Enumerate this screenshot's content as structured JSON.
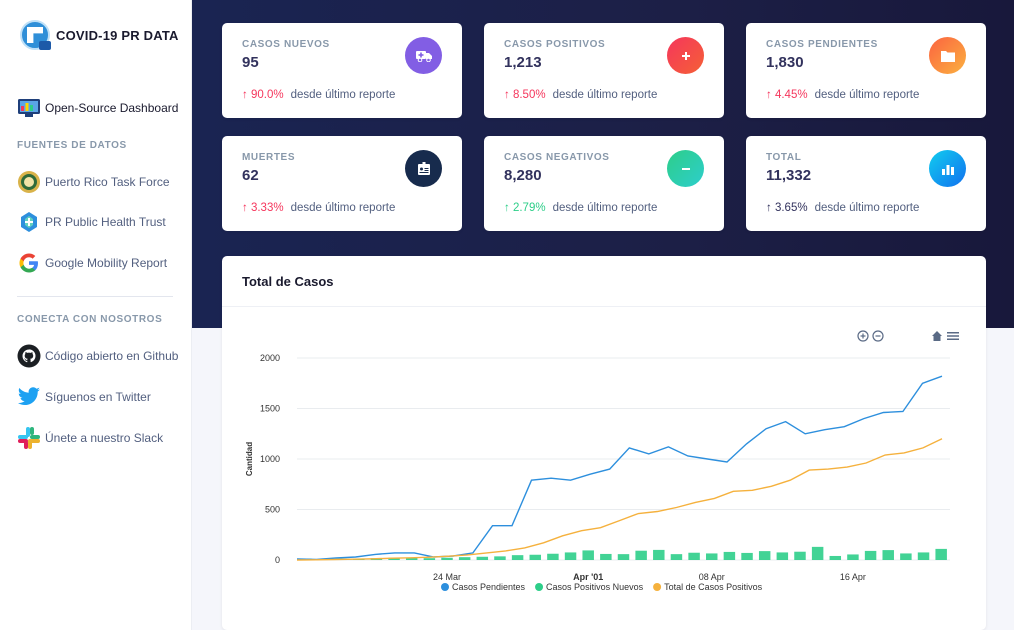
{
  "brand": {
    "title": "COVID-19 PR DATA"
  },
  "sidebar": {
    "dashboard_label": "Open-Source Dashboard",
    "section_sources": "FUENTES DE DATOS",
    "sources": [
      {
        "label": "Puerto Rico Task Force"
      },
      {
        "label": "PR Public Health Trust"
      },
      {
        "label": "Google Mobility Report"
      }
    ],
    "section_connect": "CONECTA CON NOSOTROS",
    "connect": [
      {
        "label": "Código abierto en Github"
      },
      {
        "label": "Síguenos en Twitter"
      },
      {
        "label": "Únete a nuestro Slack"
      }
    ]
  },
  "stats": [
    {
      "label": "CASOS NUEVOS",
      "value": "95",
      "change": "90.0%",
      "arrow": "↑",
      "note": "desde último reporte",
      "icon": "ambulance-icon",
      "color": "#825ee4"
    },
    {
      "label": "CASOS POSITIVOS",
      "value": "1,213",
      "change": "8.50%",
      "arrow": "↑",
      "note": "desde último reporte",
      "icon": "plus-icon",
      "color": "#f5365c"
    },
    {
      "label": "CASOS PENDIENTES",
      "value": "1,830",
      "change": "4.45%",
      "arrow": "↑",
      "note": "desde último reporte",
      "icon": "folder-icon",
      "color": "#fb6340"
    },
    {
      "label": "MUERTES",
      "value": "62",
      "change": "3.33%",
      "arrow": "↑",
      "note": "desde último reporte",
      "icon": "id-badge-icon",
      "color": "#172b4d"
    },
    {
      "label": "CASOS NEGATIVOS",
      "value": "8,280",
      "change": "2.79%",
      "arrow": "↑",
      "note": "desde último reporte",
      "icon": "minus-icon",
      "color": "#2dce89"
    },
    {
      "label": "TOTAL",
      "value": "11,332",
      "change": "3.65%",
      "arrow": "↑",
      "note": "desde último reporte",
      "icon": "bar-chart-icon",
      "color": "#11cdef"
    }
  ],
  "chart_card": {
    "title": "Total de Casos"
  },
  "chart_data": {
    "type": "line",
    "ylabel": "Cantidad",
    "ylim": [
      0,
      2000
    ],
    "yticks": [
      "0",
      "500",
      "1000",
      "1500",
      "2000"
    ],
    "x_tick_labels": [
      {
        "label": "24 Mar",
        "index": 8
      },
      {
        "label": "Apr '01",
        "index": 16
      },
      {
        "label": "08 Apr",
        "index": 23
      },
      {
        "label": "16 Apr",
        "index": 31
      }
    ],
    "series": [
      {
        "name": "Casos Pendientes",
        "type": "line",
        "color": "#2d8fdd",
        "values": [
          10,
          5,
          20,
          30,
          55,
          70,
          70,
          30,
          40,
          70,
          340,
          340,
          790,
          810,
          790,
          850,
          900,
          1110,
          1050,
          1120,
          1030,
          1000,
          970,
          1150,
          1300,
          1370,
          1250,
          1290,
          1320,
          1400,
          1460,
          1470,
          1750,
          1820
        ]
      },
      {
        "name": "Casos Positivos Nuevos",
        "type": "bar",
        "color": "#2dce89",
        "values": [
          14,
          8,
          12,
          10,
          18,
          22,
          20,
          18,
          22,
          28,
          32,
          36,
          48,
          52,
          62,
          75,
          95,
          60,
          58,
          92,
          100,
          58,
          72,
          65,
          80,
          70,
          88,
          75,
          82,
          130,
          40,
          55,
          90,
          98,
          65,
          75,
          110
        ]
      },
      {
        "name": "Total de Casos Positivos",
        "type": "line",
        "color": "#f5b13d",
        "values": [
          0,
          2,
          5,
          8,
          12,
          18,
          22,
          28,
          38,
          50,
          70,
          90,
          120,
          170,
          240,
          290,
          320,
          390,
          460,
          480,
          520,
          570,
          610,
          680,
          690,
          730,
          790,
          890,
          900,
          920,
          960,
          1040,
          1060,
          1110,
          1200
        ]
      }
    ],
    "legend": "bottom-center",
    "grid": true
  }
}
